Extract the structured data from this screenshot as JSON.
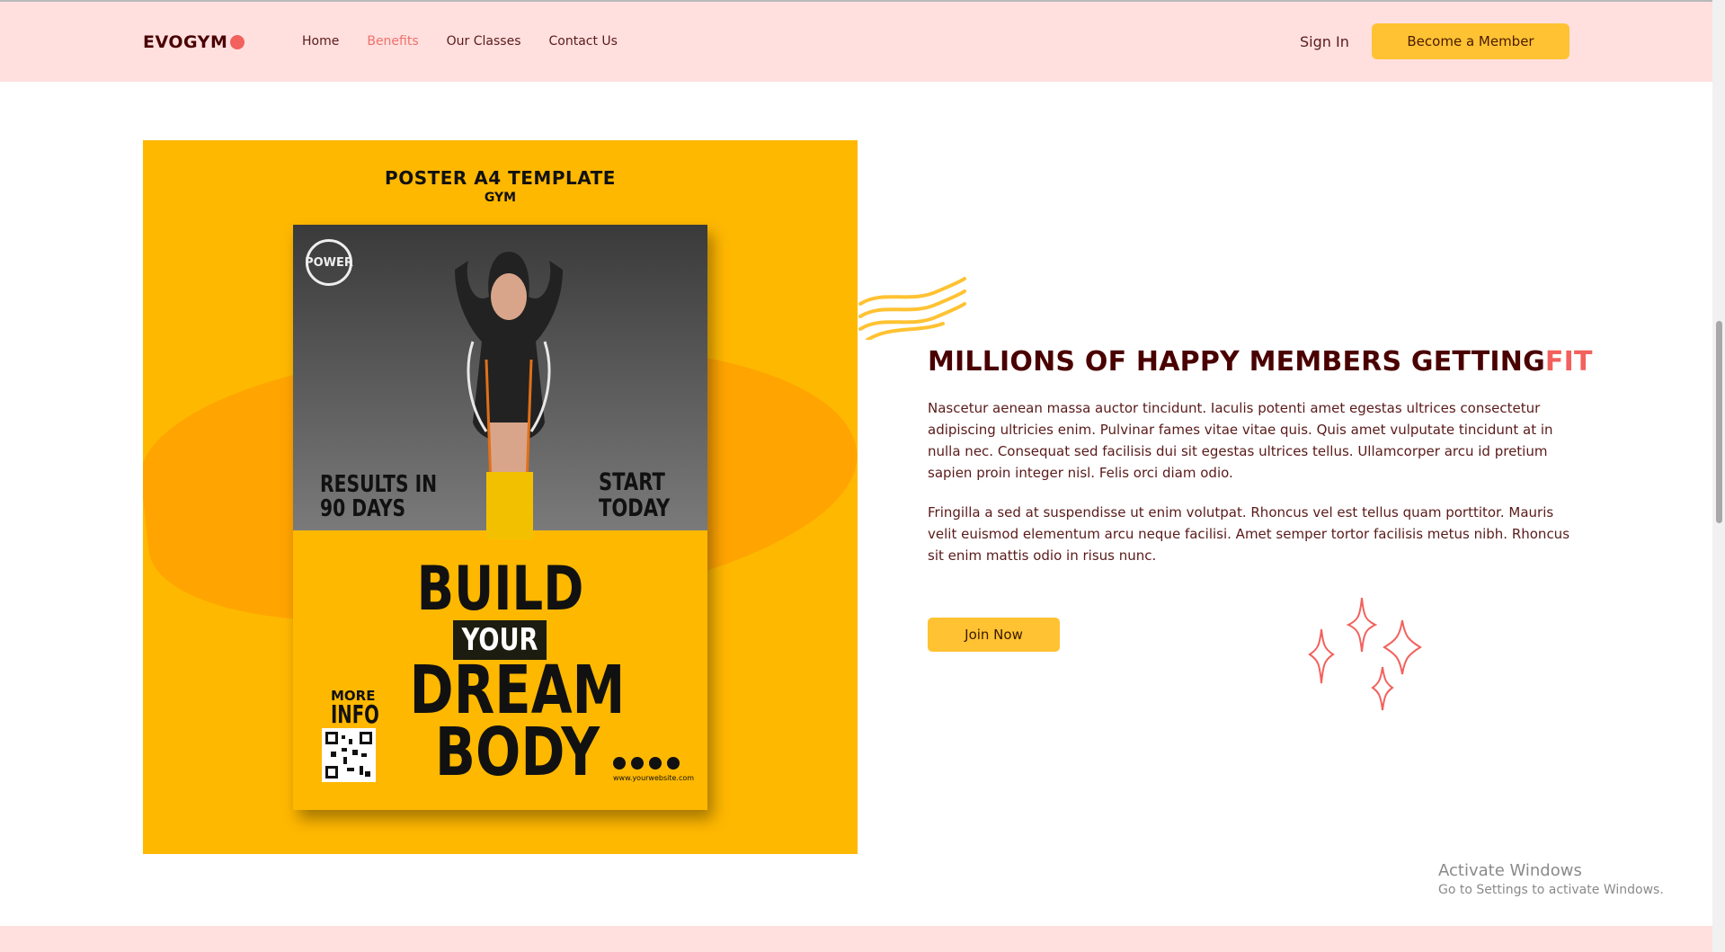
{
  "navbar": {
    "logo": "EVOGYM",
    "links": [
      "Home",
      "Benefits",
      "Our Classes",
      "Contact Us"
    ],
    "active_link": "Benefits",
    "signin": "Sign In",
    "cta": "Become a Member"
  },
  "poster": {
    "title": "POSTER A4 TEMPLATE",
    "subtitle": "GYM",
    "badge": "POWER",
    "results": [
      "RESULTS IN",
      "90 DAYS"
    ],
    "start": [
      "START",
      "TODAY"
    ],
    "build_lines": [
      "BUILD",
      "YOUR",
      "DREAM",
      "BODY"
    ],
    "more": "MORE",
    "info": "INFO",
    "website": "www.yourwebsite.com"
  },
  "content": {
    "headline_main": "MILLIONS OF HAPPY MEMBERS GETTING",
    "headline_accent": "FIT",
    "paragraph1": "Nascetur aenean massa auctor tincidunt. Iaculis potenti amet egestas ultrices consectetur adipiscing ultricies enim. Pulvinar fames vitae vitae quis. Quis amet vulputate tincidunt at in nulla nec. Consequat sed facilisis dui sit egestas ultrices tellus. Ullamcorper arcu id pretium sapien proin integer nisl. Felis orci diam odio.",
    "paragraph2": "Fringilla a sed at suspendisse ut enim volutpat. Rhoncus vel est tellus quam porttitor. Mauris velit euismod elementum arcu neque facilisi. Amet semper tortor facilisis metus nibh. Rhoncus sit enim mattis odio in risus nunc.",
    "join_button": "Join Now"
  },
  "watermark": {
    "title": "Activate Windows",
    "subtitle": "Go to Settings to activate Windows."
  },
  "colors": {
    "primary_dark": "#4a0000",
    "accent": "#f2615d",
    "yellow": "#ffc232",
    "nav_bg": "#ffe0df"
  }
}
